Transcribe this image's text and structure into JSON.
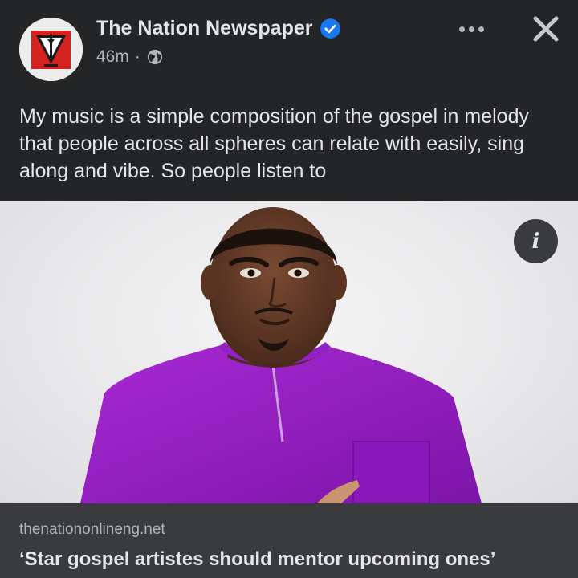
{
  "post": {
    "page_name": "The Nation Newspaper",
    "timestamp": "46m",
    "separator": "·",
    "audience_icon": "globe-icon",
    "verified_icon": "verified-badge-icon",
    "menu_icon": "more-options-icon",
    "close_icon": "close-icon",
    "text": "My music is a simple composition of the gospel in melody that people across all spheres can relate with easily, sing along and vibe. So people listen to"
  },
  "media": {
    "info_label": "i",
    "info_icon": "info-icon"
  },
  "link": {
    "domain": "thenationonlineng.net",
    "title": "‘Star gospel artistes should mentor upcoming ones’"
  },
  "colors": {
    "background": "#242526",
    "card": "#3a3b3c",
    "text_primary": "#e4e6eb",
    "text_secondary": "#b0b3b8",
    "verified_blue": "#1877f2",
    "shirt_purple": "#9a1fc6"
  }
}
